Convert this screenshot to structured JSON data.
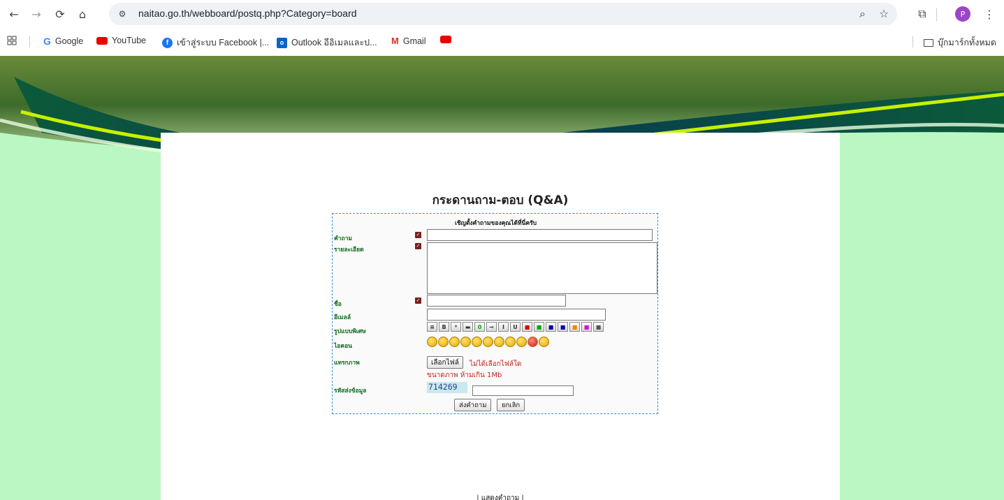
{
  "browser": {
    "url": "naitao.go.th/webboard/postq.php?Category=board",
    "bookmarks": [
      {
        "label": "Google"
      },
      {
        "label": "YouTube"
      },
      {
        "label": "เข้าสู่ระบบ Facebook |..."
      },
      {
        "label": "Outlook อีอิเมลและป..."
      },
      {
        "label": "Gmail"
      },
      {
        "label": ""
      }
    ],
    "all_bookmarks": "บุ๊กมาร์กทั้งหมด",
    "profile_initial": "P"
  },
  "page": {
    "title": "กระดานถาม-ตอบ (Q&A)",
    "form_heading": "เชิญตั้งคำถามของคุณได้ที่นี่ครับ",
    "labels": {
      "question": "คำถาม",
      "detail": "รายละเอียด",
      "name": "ชื่อ",
      "email": "อีเมลล์",
      "format": "รูปแบบพิเศษ",
      "icons": "ไอคอน",
      "image": "แทรกภาพ",
      "code": "รหัสส่งข้อมูล"
    },
    "file_button": "เลือกไฟล์",
    "no_file": "ไม่ได้เลือกไฟล์ใด",
    "size_note": "ขนาดภาพ ห้ามเกิน 1Mb",
    "captcha_code": "714269",
    "submit_label": "ส่งคำถาม",
    "cancel_label": "ยกเลิก",
    "show_link": "| แสดงคำถาม |"
  },
  "format_buttons": [
    "≡",
    "B",
    "⁰",
    "▬",
    "0",
    "⊸",
    "I",
    "U",
    "■",
    "■",
    "■",
    "■",
    "■",
    "■",
    "■"
  ],
  "format_colors": [
    "#333",
    "#333",
    "#333",
    "#333",
    "#0a0",
    "#333",
    "#333",
    "#333",
    "#d00",
    "#0a0",
    "#00a",
    "#00a",
    "#e80",
    "#d0d",
    "#555"
  ],
  "emoticon_count": 11,
  "colors": {
    "page_bg": "#baf7c2",
    "label_green": "#0a6a1a",
    "form_border": "#3a8fd6",
    "warning_red": "#c0261d"
  }
}
